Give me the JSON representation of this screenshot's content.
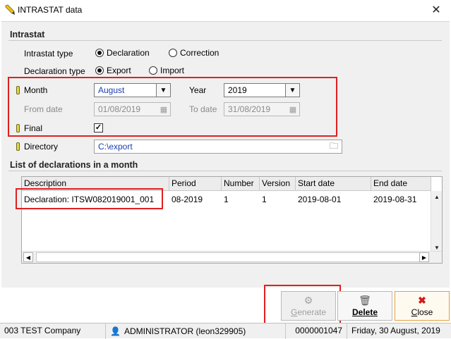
{
  "window": {
    "title": "INTRASTAT data",
    "close_glyph": "✕"
  },
  "intrastat": {
    "section_title": "Intrastat",
    "type_label": "Intrastat type",
    "type_options": [
      {
        "label": "Declaration",
        "selected": true
      },
      {
        "label": "Correction",
        "selected": false
      }
    ],
    "decl_type_label": "Declaration type",
    "decl_type_options": [
      {
        "label": "Export",
        "selected": true
      },
      {
        "label": "Import",
        "selected": false
      }
    ],
    "month_label": "Month",
    "month_value": "August",
    "year_label": "Year",
    "year_value": "2019",
    "from_date_label": "From date",
    "from_date_value": "01/08/2019",
    "to_date_label": "To date",
    "to_date_value": "31/08/2019",
    "final_label": "Final",
    "final_checked": true,
    "directory_label": "Directory",
    "directory_value": "C:\\export"
  },
  "declarations": {
    "section_title": "List of declarations in a month",
    "columns": [
      "Description",
      "Period",
      "Number",
      "Version",
      "Start date",
      "End date"
    ],
    "rows": [
      [
        "Declaration: ITSW082019001_001",
        "08-2019",
        "1",
        "1",
        "2019-08-01",
        "2019-08-31"
      ]
    ]
  },
  "buttons": {
    "generate": "Generate",
    "delete": "Delete",
    "close": "Close"
  },
  "statusbar": {
    "company": "003 TEST Company",
    "user": "ADMINISTRATOR (leon329905)",
    "code": "0000001047",
    "date": "Friday, 30 August, 2019"
  },
  "colors": {
    "highlight_border": "#e02020",
    "link_blue": "#1a3fb0",
    "close_accent": "#e2a23b"
  }
}
